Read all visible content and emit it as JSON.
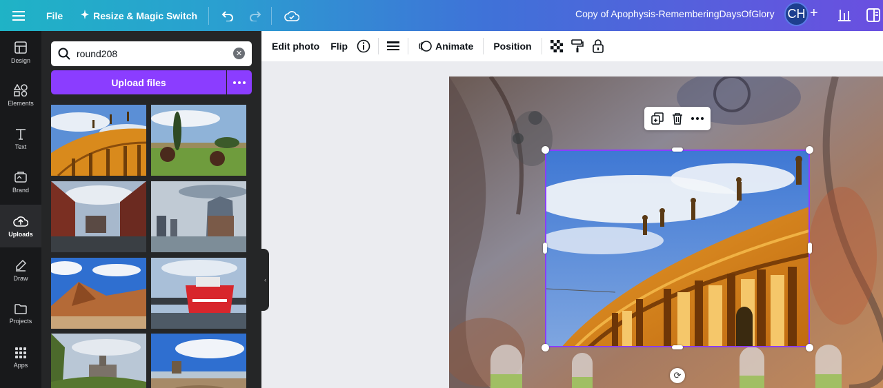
{
  "topbar": {
    "menu_icon": "hamburger-icon",
    "file_label": "File",
    "resize_label": "Resize & Magic Switch",
    "undo_icon": "undo-icon",
    "redo_icon": "redo-icon",
    "cloud_icon": "cloud-check-icon",
    "doc_title": "Copy of Apophysis-RememberingDaysOfGlory",
    "avatar_initials": "CH",
    "plus_label": "+",
    "gradient_start": "#1fb3c6",
    "gradient_end": "#6a4fe0"
  },
  "rail": {
    "items": [
      {
        "label": "Design",
        "icon": "layout-icon"
      },
      {
        "label": "Elements",
        "icon": "shapes-icon"
      },
      {
        "label": "Text",
        "icon": "text-icon"
      },
      {
        "label": "Brand",
        "icon": "brand-icon"
      },
      {
        "label": "Uploads",
        "icon": "upload-cloud-icon",
        "active": true
      },
      {
        "label": "Draw",
        "icon": "pen-icon"
      },
      {
        "label": "Projects",
        "icon": "folder-icon"
      },
      {
        "label": "Apps",
        "icon": "apps-grid-icon"
      }
    ]
  },
  "uploads": {
    "search_value": "round208",
    "upload_label": "Upload files",
    "accent": "#8b3dff",
    "thumbnails": [
      "curved-building-statues",
      "garden-topiary",
      "warehouse-canal",
      "harbour-skyline",
      "desert-mountain",
      "red-ship",
      "castle-ruin",
      "stone-tower-beach"
    ]
  },
  "context_toolbar": {
    "edit_photo": "Edit photo",
    "flip": "Flip",
    "animate": "Animate",
    "position": "Position"
  },
  "canvas": {
    "selected_image": "curved-building-statues"
  }
}
